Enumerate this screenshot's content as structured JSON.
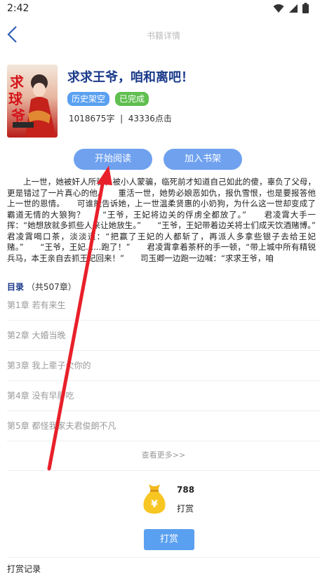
{
  "status_bar": {
    "time": "2:42"
  },
  "header": {
    "title": "书籍详情"
  },
  "book": {
    "title": "求求王爷，咱和离吧！",
    "tags": [
      "历史架空",
      "已完成"
    ],
    "stats": "1018675字  |  43336点击"
  },
  "actions": {
    "read_label": "开始阅读",
    "shelf_label": "加入书架"
  },
  "synopsis": "上一世，她被奸人所骗，被小人蒙骗，临死前才知道自己如此的傻，辜负了父母，更是错过了一片真心的他。　　重活一世，她势必娘恶如仇，报仇雪恨，也是要报答他上一世的恩情。　　可谁能告诉她，上一世温柔贤惠的小奶狗，为什么这一世却变成了霸道无情的大狼狗？　　“王爷，王妃将边关的俘虏全都放了。”　　君凌霄大手一挥：“她想放就多抓些人来让她放生。”　　“王爷，王妃带着边关将士们成天饮酒赌博。”　　君凌霄喝口茶，淡淡道：“把赢了王妃的人都斩了，再派人多拿些银子去给王妃赌。”　　“王爷，王妃......跑了！”　　君凌霄拿着茶杯的手一顿，“带上城中所有精锐兵马，本王亲自去抓王妃回来！”　　司玉卿一边跑一边喊：“求求王爷，咱",
  "toc": {
    "label": "目录",
    "count": "（共507章）",
    "chapters": [
      "第1章 若有来生",
      "第2章 大婚当晚",
      "第3章 我上辈子欠你的",
      "第4章 没有早肝吃",
      "第5章 都怪我家夫君俊朗不凡"
    ],
    "see_more": "查看更多>>"
  },
  "reward": {
    "count": "788",
    "label": "打赏",
    "button_label": "打赏",
    "record_label": "打赏记录"
  },
  "colors": {
    "accent": "#6fa1ef",
    "title": "#1a3a8a",
    "tag_green": "#5fbf4f",
    "arrow": "#e8202a"
  },
  "icons": [
    "back-arrow-icon",
    "wifi-icon",
    "signal-icon",
    "battery-icon",
    "money-bag-icon"
  ]
}
